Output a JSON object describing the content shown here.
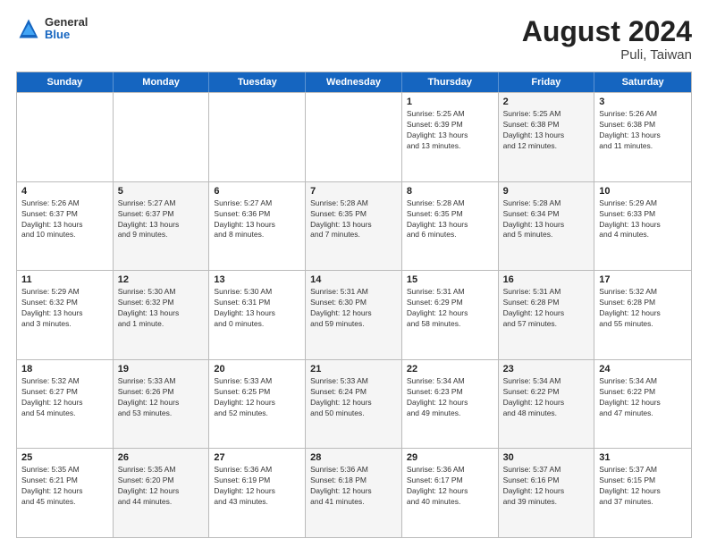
{
  "header": {
    "logo": {
      "line1": "General",
      "line2": "Blue"
    },
    "title": "August 2024",
    "location": "Puli, Taiwan"
  },
  "weekdays": [
    "Sunday",
    "Monday",
    "Tuesday",
    "Wednesday",
    "Thursday",
    "Friday",
    "Saturday"
  ],
  "rows": [
    [
      {
        "day": "",
        "info": "",
        "shaded": false,
        "empty": true
      },
      {
        "day": "",
        "info": "",
        "shaded": false,
        "empty": true
      },
      {
        "day": "",
        "info": "",
        "shaded": false,
        "empty": true
      },
      {
        "day": "",
        "info": "",
        "shaded": false,
        "empty": true
      },
      {
        "day": "1",
        "info": "Sunrise: 5:25 AM\nSunset: 6:39 PM\nDaylight: 13 hours\nand 13 minutes.",
        "shaded": false
      },
      {
        "day": "2",
        "info": "Sunrise: 5:25 AM\nSunset: 6:38 PM\nDaylight: 13 hours\nand 12 minutes.",
        "shaded": true
      },
      {
        "day": "3",
        "info": "Sunrise: 5:26 AM\nSunset: 6:38 PM\nDaylight: 13 hours\nand 11 minutes.",
        "shaded": false
      }
    ],
    [
      {
        "day": "4",
        "info": "Sunrise: 5:26 AM\nSunset: 6:37 PM\nDaylight: 13 hours\nand 10 minutes.",
        "shaded": false
      },
      {
        "day": "5",
        "info": "Sunrise: 5:27 AM\nSunset: 6:37 PM\nDaylight: 13 hours\nand 9 minutes.",
        "shaded": true
      },
      {
        "day": "6",
        "info": "Sunrise: 5:27 AM\nSunset: 6:36 PM\nDaylight: 13 hours\nand 8 minutes.",
        "shaded": false
      },
      {
        "day": "7",
        "info": "Sunrise: 5:28 AM\nSunset: 6:35 PM\nDaylight: 13 hours\nand 7 minutes.",
        "shaded": true
      },
      {
        "day": "8",
        "info": "Sunrise: 5:28 AM\nSunset: 6:35 PM\nDaylight: 13 hours\nand 6 minutes.",
        "shaded": false
      },
      {
        "day": "9",
        "info": "Sunrise: 5:28 AM\nSunset: 6:34 PM\nDaylight: 13 hours\nand 5 minutes.",
        "shaded": true
      },
      {
        "day": "10",
        "info": "Sunrise: 5:29 AM\nSunset: 6:33 PM\nDaylight: 13 hours\nand 4 minutes.",
        "shaded": false
      }
    ],
    [
      {
        "day": "11",
        "info": "Sunrise: 5:29 AM\nSunset: 6:32 PM\nDaylight: 13 hours\nand 3 minutes.",
        "shaded": false
      },
      {
        "day": "12",
        "info": "Sunrise: 5:30 AM\nSunset: 6:32 PM\nDaylight: 13 hours\nand 1 minute.",
        "shaded": true
      },
      {
        "day": "13",
        "info": "Sunrise: 5:30 AM\nSunset: 6:31 PM\nDaylight: 13 hours\nand 0 minutes.",
        "shaded": false
      },
      {
        "day": "14",
        "info": "Sunrise: 5:31 AM\nSunset: 6:30 PM\nDaylight: 12 hours\nand 59 minutes.",
        "shaded": true
      },
      {
        "day": "15",
        "info": "Sunrise: 5:31 AM\nSunset: 6:29 PM\nDaylight: 12 hours\nand 58 minutes.",
        "shaded": false
      },
      {
        "day": "16",
        "info": "Sunrise: 5:31 AM\nSunset: 6:28 PM\nDaylight: 12 hours\nand 57 minutes.",
        "shaded": true
      },
      {
        "day": "17",
        "info": "Sunrise: 5:32 AM\nSunset: 6:28 PM\nDaylight: 12 hours\nand 55 minutes.",
        "shaded": false
      }
    ],
    [
      {
        "day": "18",
        "info": "Sunrise: 5:32 AM\nSunset: 6:27 PM\nDaylight: 12 hours\nand 54 minutes.",
        "shaded": false
      },
      {
        "day": "19",
        "info": "Sunrise: 5:33 AM\nSunset: 6:26 PM\nDaylight: 12 hours\nand 53 minutes.",
        "shaded": true
      },
      {
        "day": "20",
        "info": "Sunrise: 5:33 AM\nSunset: 6:25 PM\nDaylight: 12 hours\nand 52 minutes.",
        "shaded": false
      },
      {
        "day": "21",
        "info": "Sunrise: 5:33 AM\nSunset: 6:24 PM\nDaylight: 12 hours\nand 50 minutes.",
        "shaded": true
      },
      {
        "day": "22",
        "info": "Sunrise: 5:34 AM\nSunset: 6:23 PM\nDaylight: 12 hours\nand 49 minutes.",
        "shaded": false
      },
      {
        "day": "23",
        "info": "Sunrise: 5:34 AM\nSunset: 6:22 PM\nDaylight: 12 hours\nand 48 minutes.",
        "shaded": true
      },
      {
        "day": "24",
        "info": "Sunrise: 5:34 AM\nSunset: 6:22 PM\nDaylight: 12 hours\nand 47 minutes.",
        "shaded": false
      }
    ],
    [
      {
        "day": "25",
        "info": "Sunrise: 5:35 AM\nSunset: 6:21 PM\nDaylight: 12 hours\nand 45 minutes.",
        "shaded": false
      },
      {
        "day": "26",
        "info": "Sunrise: 5:35 AM\nSunset: 6:20 PM\nDaylight: 12 hours\nand 44 minutes.",
        "shaded": true
      },
      {
        "day": "27",
        "info": "Sunrise: 5:36 AM\nSunset: 6:19 PM\nDaylight: 12 hours\nand 43 minutes.",
        "shaded": false
      },
      {
        "day": "28",
        "info": "Sunrise: 5:36 AM\nSunset: 6:18 PM\nDaylight: 12 hours\nand 41 minutes.",
        "shaded": true
      },
      {
        "day": "29",
        "info": "Sunrise: 5:36 AM\nSunset: 6:17 PM\nDaylight: 12 hours\nand 40 minutes.",
        "shaded": false
      },
      {
        "day": "30",
        "info": "Sunrise: 5:37 AM\nSunset: 6:16 PM\nDaylight: 12 hours\nand 39 minutes.",
        "shaded": true
      },
      {
        "day": "31",
        "info": "Sunrise: 5:37 AM\nSunset: 6:15 PM\nDaylight: 12 hours\nand 37 minutes.",
        "shaded": false
      }
    ]
  ]
}
